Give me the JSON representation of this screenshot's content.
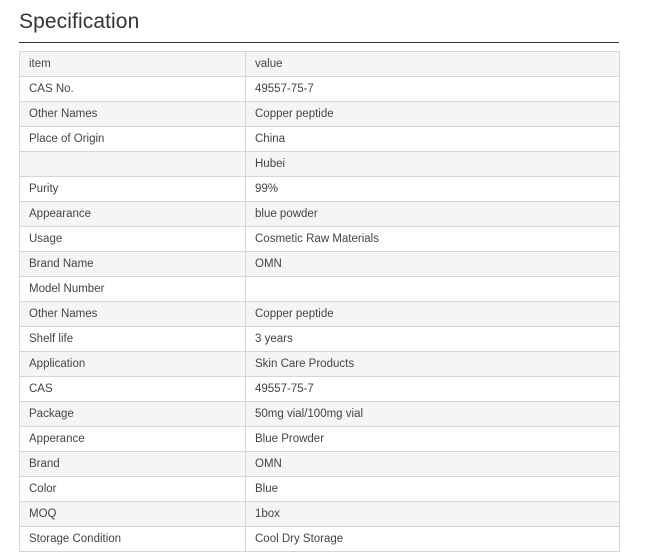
{
  "title": "Specification",
  "table": {
    "rows": [
      {
        "item": "item",
        "value": "value"
      },
      {
        "item": "CAS No.",
        "value": "49557-75-7"
      },
      {
        "item": "Other Names",
        "value": "Copper peptide"
      },
      {
        "item": "Place of Origin",
        "value": "China"
      },
      {
        "item": "",
        "value": "Hubei"
      },
      {
        "item": "Purity",
        "value": "99%"
      },
      {
        "item": "Appearance",
        "value": "blue powder"
      },
      {
        "item": "Usage",
        "value": "Cosmetic Raw Materials"
      },
      {
        "item": "Brand Name",
        "value": "OMN"
      },
      {
        "item": "Model Number",
        "value": ""
      },
      {
        "item": "Other Names",
        "value": "Copper peptide"
      },
      {
        "item": "Shelf life",
        "value": "3 years"
      },
      {
        "item": "Application",
        "value": "Skin Care Products"
      },
      {
        "item": "CAS",
        "value": "49557-75-7"
      },
      {
        "item": "Package",
        "value": "50mg vial/100mg vial"
      },
      {
        "item": "Apperance",
        "value": "Blue Prowder"
      },
      {
        "item": "Brand",
        "value": "OMN"
      },
      {
        "item": "Color",
        "value": "Blue"
      },
      {
        "item": "MOQ",
        "value": "1box"
      },
      {
        "item": "Storage Condition",
        "value": "Cool Dry Storage"
      }
    ]
  }
}
